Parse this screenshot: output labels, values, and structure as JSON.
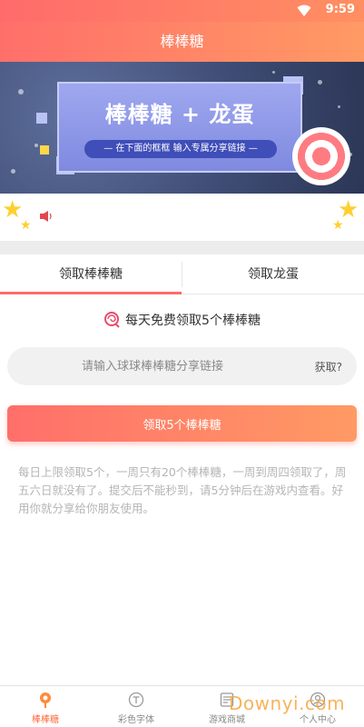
{
  "status_bar": {
    "time": "9:59"
  },
  "header": {
    "title": "棒棒糖"
  },
  "banner": {
    "title": "棒棒糖 + 龙蛋",
    "subtitle": "— 在下面的框框 输入专属分享链接 —"
  },
  "tabs": [
    {
      "label": "领取棒棒糖",
      "active": true
    },
    {
      "label": "领取龙蛋",
      "active": false
    }
  ],
  "daily_text": "每天免费领取5个棒棒糖",
  "input": {
    "placeholder": "请输入球球棒棒糖分享链接",
    "value": "",
    "help_link": "获取?"
  },
  "claim_button": "领取5个棒棒糖",
  "description": "每日上限领取5个，一周只有20个棒棒糖，一周到周四领取了，周五六日就没有了。提交后不能秒到，请5分钟后在游戏内查看。好用你就分享给你朋友使用。",
  "bottom_nav": [
    {
      "label": "棒棒糖",
      "icon": "lollipop-icon",
      "active": true
    },
    {
      "label": "彩色字体",
      "icon": "font-icon",
      "active": false
    },
    {
      "label": "游戏商城",
      "icon": "shop-icon",
      "active": false
    },
    {
      "label": "个人中心",
      "icon": "person-icon",
      "active": false
    }
  ],
  "watermark": "Downyi.com",
  "colors": {
    "accent": "#ff6b6b",
    "accent_end": "#ff9a64",
    "nav_active": "#ff6b3c"
  }
}
